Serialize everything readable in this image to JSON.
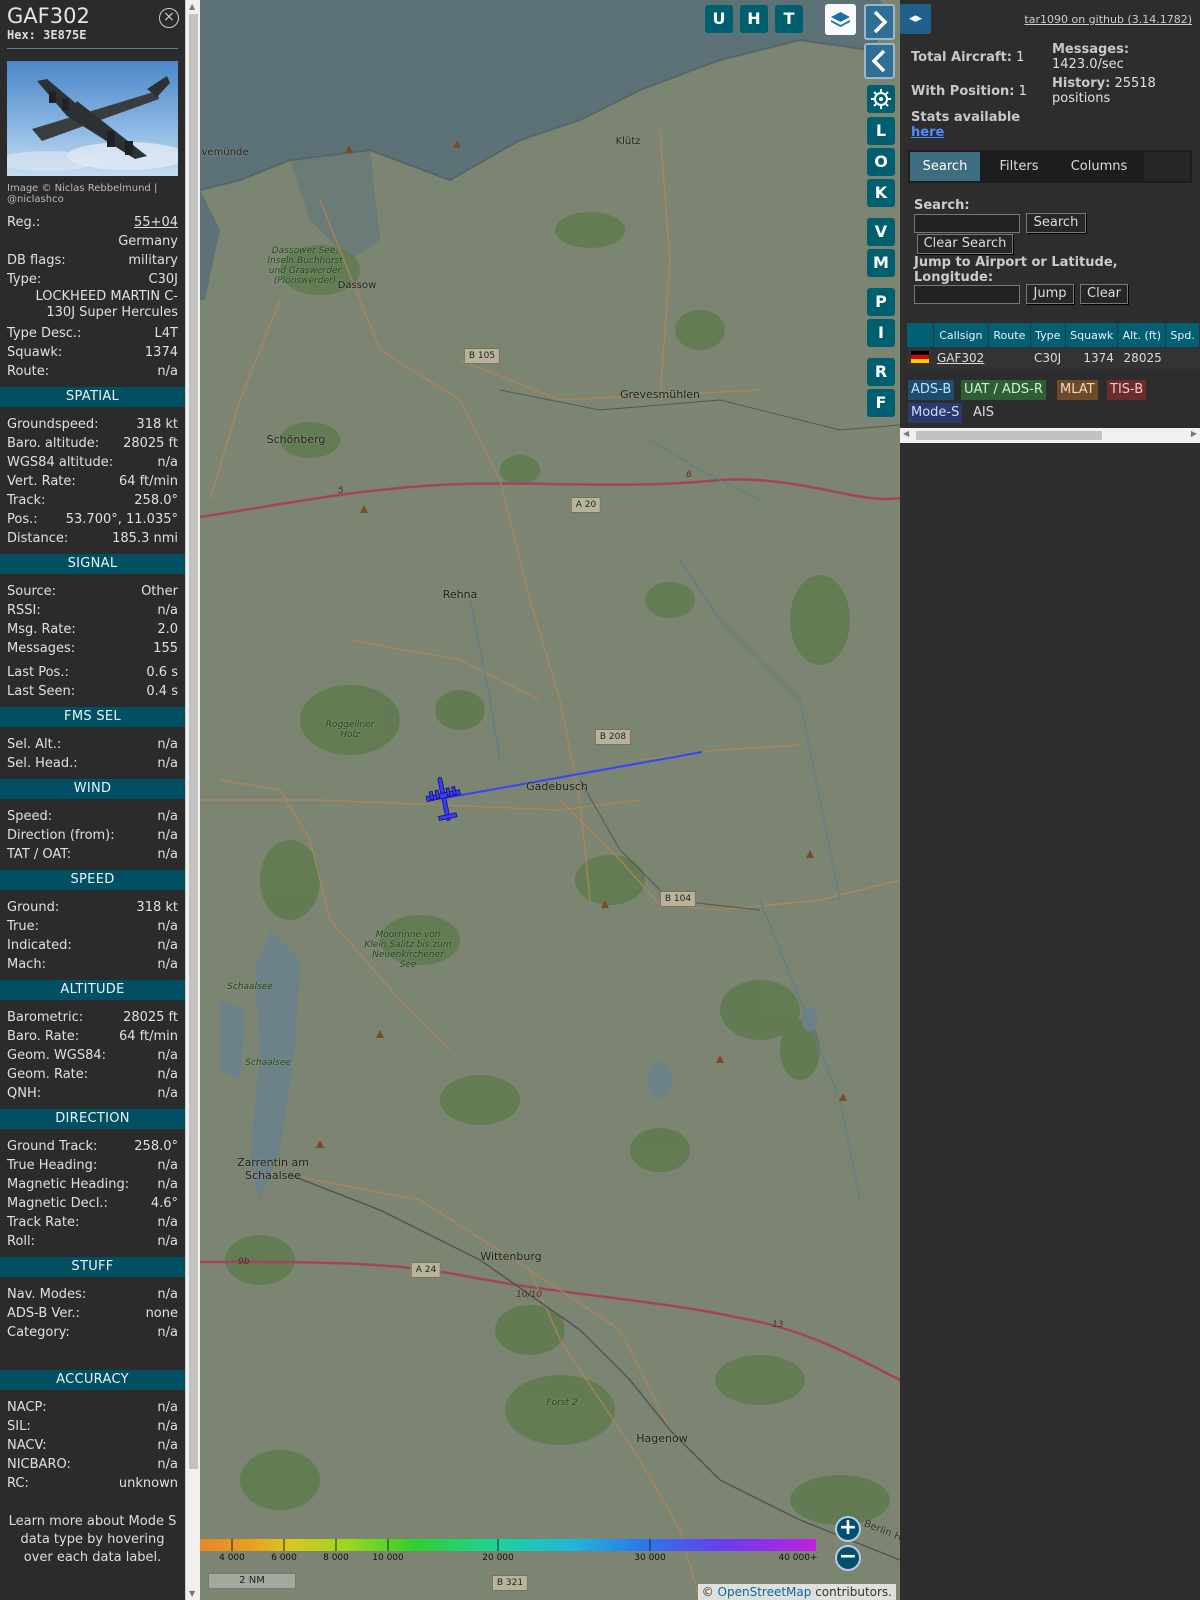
{
  "info": {
    "callsign": "GAF302",
    "hex_label": "Hex:",
    "hex": "3E875E",
    "close_glyph": "×",
    "photo_credit": "Image © Niclas Rebbelmund | @niclashco",
    "rows_top": [
      {
        "label": "Reg.:",
        "value": "55+04"
      },
      {
        "label": "",
        "value": "Germany"
      },
      {
        "label": "DB flags:",
        "value": "military"
      },
      {
        "label": "Type:",
        "value": "C30J"
      }
    ],
    "type_name": "LOCKHEED MARTIN C-130J Super Hercules",
    "rows_after": [
      {
        "label": "Type Desc.:",
        "value": "L4T"
      },
      {
        "label": "Squawk:",
        "value": "1374"
      },
      {
        "label": "Route:",
        "value": "n/a"
      }
    ],
    "sections": [
      {
        "title": "SPATIAL",
        "rows": [
          {
            "label": "Groundspeed:",
            "value": "318 kt"
          },
          {
            "label": "Baro. altitude:",
            "value": "28025 ft"
          },
          {
            "label": "WGS84 altitude:",
            "value": "n/a"
          },
          {
            "label": "Vert. Rate:",
            "value": "64 ft/min"
          },
          {
            "label": "Track:",
            "value": "258.0°"
          },
          {
            "label": "Pos.:",
            "value": "53.700°, 11.035°"
          },
          {
            "label": "Distance:",
            "value": "185.3 nmi"
          }
        ]
      },
      {
        "title": "SIGNAL",
        "rows": [
          {
            "label": "Source:",
            "value": "Other"
          },
          {
            "label": "RSSI:",
            "value": "n/a"
          },
          {
            "label": "Msg. Rate:",
            "value": "2.0"
          },
          {
            "label": "Messages:",
            "value": "155"
          },
          {
            "label": "Last Pos.:",
            "value": "0.6 s"
          },
          {
            "label": "Last Seen:",
            "value": "0.4 s"
          }
        ]
      },
      {
        "title": "FMS SEL",
        "rows": [
          {
            "label": "Sel. Alt.:",
            "value": "n/a"
          },
          {
            "label": "Sel. Head.:",
            "value": "n/a"
          }
        ]
      },
      {
        "title": "WIND",
        "rows": [
          {
            "label": "Speed:",
            "value": "n/a"
          },
          {
            "label": "Direction (from):",
            "value": "n/a"
          },
          {
            "label": "TAT / OAT:",
            "value": "n/a"
          }
        ]
      },
      {
        "title": "SPEED",
        "rows": [
          {
            "label": "Ground:",
            "value": "318 kt"
          },
          {
            "label": "True:",
            "value": "n/a"
          },
          {
            "label": "Indicated:",
            "value": "n/a"
          },
          {
            "label": "Mach:",
            "value": "n/a"
          }
        ]
      },
      {
        "title": "ALTITUDE",
        "rows": [
          {
            "label": "Barometric:",
            "value": "28025 ft"
          },
          {
            "label": "Baro. Rate:",
            "value": "64 ft/min"
          },
          {
            "label": "Geom. WGS84:",
            "value": "n/a"
          },
          {
            "label": "Geom. Rate:",
            "value": "n/a"
          },
          {
            "label": "QNH:",
            "value": "n/a"
          }
        ]
      },
      {
        "title": "DIRECTION",
        "rows": [
          {
            "label": "Ground Track:",
            "value": "258.0°"
          },
          {
            "label": "True Heading:",
            "value": "n/a"
          },
          {
            "label": "Magnetic Heading:",
            "value": "n/a"
          },
          {
            "label": "Magnetic Decl.:",
            "value": "4.6°"
          },
          {
            "label": "Track Rate:",
            "value": "n/a"
          },
          {
            "label": "Roll:",
            "value": "n/a"
          }
        ]
      },
      {
        "title": "STUFF",
        "rows": [
          {
            "label": "Nav. Modes:",
            "value": "n/a"
          },
          {
            "label": "ADS-B Ver.:",
            "value": "none"
          },
          {
            "label": "Category:",
            "value": "n/a"
          }
        ]
      },
      {
        "title": "ACCURACY",
        "rows": [
          {
            "label": "NACP:",
            "value": "n/a"
          },
          {
            "label": "SIL:",
            "value": "n/a"
          },
          {
            "label": "NACV:",
            "value": "n/a"
          },
          {
            "label": "NICBARO:",
            "value": "n/a"
          },
          {
            "label": "RC:",
            "value": "unknown"
          }
        ]
      }
    ],
    "learn_more": "Learn more about Mode S data type by hovering over each data label."
  },
  "map": {
    "places": [
      {
        "name": "vemünde",
        "cls": "small"
      },
      {
        "name": "Klütz",
        "cls": "small"
      },
      {
        "name": "Dassow",
        "cls": "small"
      },
      {
        "name": "Grevesmühlen",
        "cls": ""
      },
      {
        "name": "Schönberg",
        "cls": ""
      },
      {
        "name": "Rehna",
        "cls": ""
      },
      {
        "name": "Gadebusch",
        "cls": ""
      },
      {
        "name": "Zarrentin am Schaalsee",
        "cls": ""
      },
      {
        "name": "Wittenburg",
        "cls": ""
      },
      {
        "name": "Hagenow",
        "cls": ""
      }
    ],
    "nature": [
      "Dassower See, Inseln Buchhorst und Graswerder (Plönswerder)",
      "Roggeliner Holz",
      "Moorrinne von Klein Salitz bis zum Neuenkirchener See",
      "Schaalsee",
      "Schaalsee",
      "Forst 2"
    ],
    "roads": [
      "B 105",
      "A 20",
      "B 208",
      "B 104",
      "A 24",
      "B 321"
    ],
    "road_numbers": [
      "6",
      "5",
      "9b",
      "10/10",
      "13"
    ],
    "edge_label": "Berlin Hamburger Bahn",
    "buttons": {
      "u": "U",
      "h": "H",
      "t": "T",
      "l": "L",
      "o": "O",
      "k": "K",
      "v": "V",
      "m": "M",
      "p": "P",
      "i": "I",
      "r": "R",
      "f": "F"
    },
    "colorbar_labels": [
      "4 000",
      "6 000",
      "8 000",
      "10 000",
      "20 000",
      "30 000",
      "40 000+"
    ],
    "scale_label": "2 NM",
    "attribution_prefix": "©",
    "attribution_link": "OpenStreetMap",
    "attribution_suffix": "contributors.",
    "zoom_in": "+",
    "zoom_out": "−"
  },
  "sidebar": {
    "github": "tar1090 on github (3.14.1782)",
    "total_label": "Total Aircraft:",
    "total": "1",
    "with_pos_label": "With Position:",
    "with_pos": "1",
    "messages_label": "Messages:",
    "messages": "1423.0/sec",
    "history_label": "History:",
    "history": "25518 positions",
    "stats_text": "Stats available",
    "stats_link": "here",
    "tabs": [
      "Search",
      "Filters",
      "Columns"
    ],
    "search_label": "Search:",
    "search_button": "Search",
    "clear_search_button": "Clear Search",
    "jump_label": "Jump to Airport or Latitude, Longitude:",
    "jump_button": "Jump",
    "clear_button": "Clear",
    "table": {
      "headers": [
        "",
        "Callsign",
        "Route",
        "Type",
        "Squawk",
        "Alt. (ft)",
        "Spd."
      ],
      "rows": [
        {
          "callsign": "GAF302",
          "route": "",
          "type": "C30J",
          "squawk": "1374",
          "alt": "28025",
          "spd": ""
        }
      ]
    },
    "sources": [
      {
        "label": "ADS-B",
        "bg": "#1f4d6e",
        "fg": "#bfe0ff"
      },
      {
        "label": "UAT / ADS-R",
        "bg": "#2d5e35",
        "fg": "#d0f0d0"
      },
      {
        "label": "MLAT",
        "bg": "#6e4a2a",
        "fg": "#f0d8c0"
      },
      {
        "label": "TIS-B",
        "bg": "#6a2c2c",
        "fg": "#f0c8c8"
      },
      {
        "label": "Mode-S",
        "bg": "#2a3a6a",
        "fg": "#cfd8ff"
      },
      {
        "label": "AIS",
        "bg": "#2d2d2d",
        "fg": "#dddddd"
      }
    ]
  },
  "colors": {
    "section_bg": "#004f62",
    "track_line": "#3344ff",
    "aircraft": "#3b3bff"
  }
}
